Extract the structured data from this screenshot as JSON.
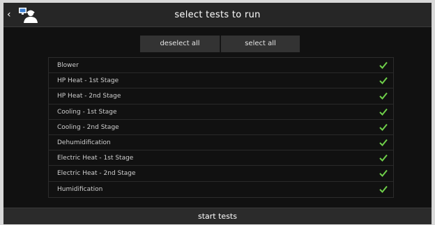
{
  "header": {
    "title": "select tests to run",
    "back_glyph": "‹"
  },
  "icons": {
    "back": "chevron-left-icon",
    "logo": "technician-computer-icon",
    "check": "checkmark-icon"
  },
  "colors": {
    "check": "#6fd04a",
    "background": "#111111",
    "header": "#262626"
  },
  "selection": {
    "deselect_all_label": "deselect all",
    "select_all_label": "select all"
  },
  "tests": [
    {
      "label": "Blower",
      "checked": true
    },
    {
      "label": "HP Heat - 1st Stage",
      "checked": true
    },
    {
      "label": "HP Heat - 2nd Stage",
      "checked": true
    },
    {
      "label": "Cooling - 1st Stage",
      "checked": true
    },
    {
      "label": "Cooling - 2nd Stage",
      "checked": true
    },
    {
      "label": "Dehumidification",
      "checked": true
    },
    {
      "label": "Electric Heat - 1st Stage",
      "checked": true
    },
    {
      "label": "Electric Heat - 2nd Stage",
      "checked": true
    },
    {
      "label": "Humidification",
      "checked": true
    }
  ],
  "footer": {
    "start_label": "start tests"
  }
}
